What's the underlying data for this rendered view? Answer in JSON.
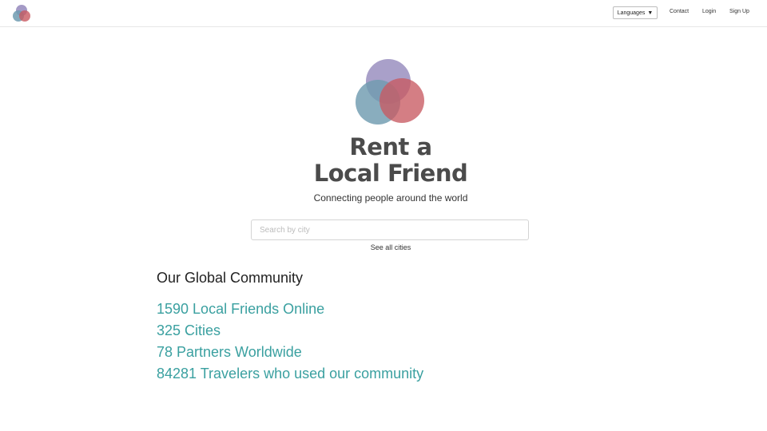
{
  "nav": {
    "logo_icon": "overlapping-circles-logo-icon",
    "languages_label": "Languages",
    "languages_caret_icon": "caret-down-icon",
    "links": [
      "Contact",
      "Login",
      "Sign Up"
    ]
  },
  "hero": {
    "logo_icon": "overlapping-circles-logo-icon",
    "title_line1": "Rent a",
    "title_line2": "Local Friend",
    "subtitle": "Connecting people around the world"
  },
  "search": {
    "placeholder": "Search by city",
    "value": "",
    "see_all_label": "See all cities"
  },
  "community": {
    "heading": "Our Global Community",
    "stats": [
      "1590 Local Friends Online",
      "325 Cities",
      "78 Partners Worldwide",
      "84281 Travelers who used our community"
    ]
  },
  "colors": {
    "accent_teal": "#3aa0a0",
    "logo_purple": "#9a8fc0",
    "logo_blue": "#6f9bb0",
    "logo_red": "#c85a62",
    "title_gray": "#4b4b4b"
  }
}
